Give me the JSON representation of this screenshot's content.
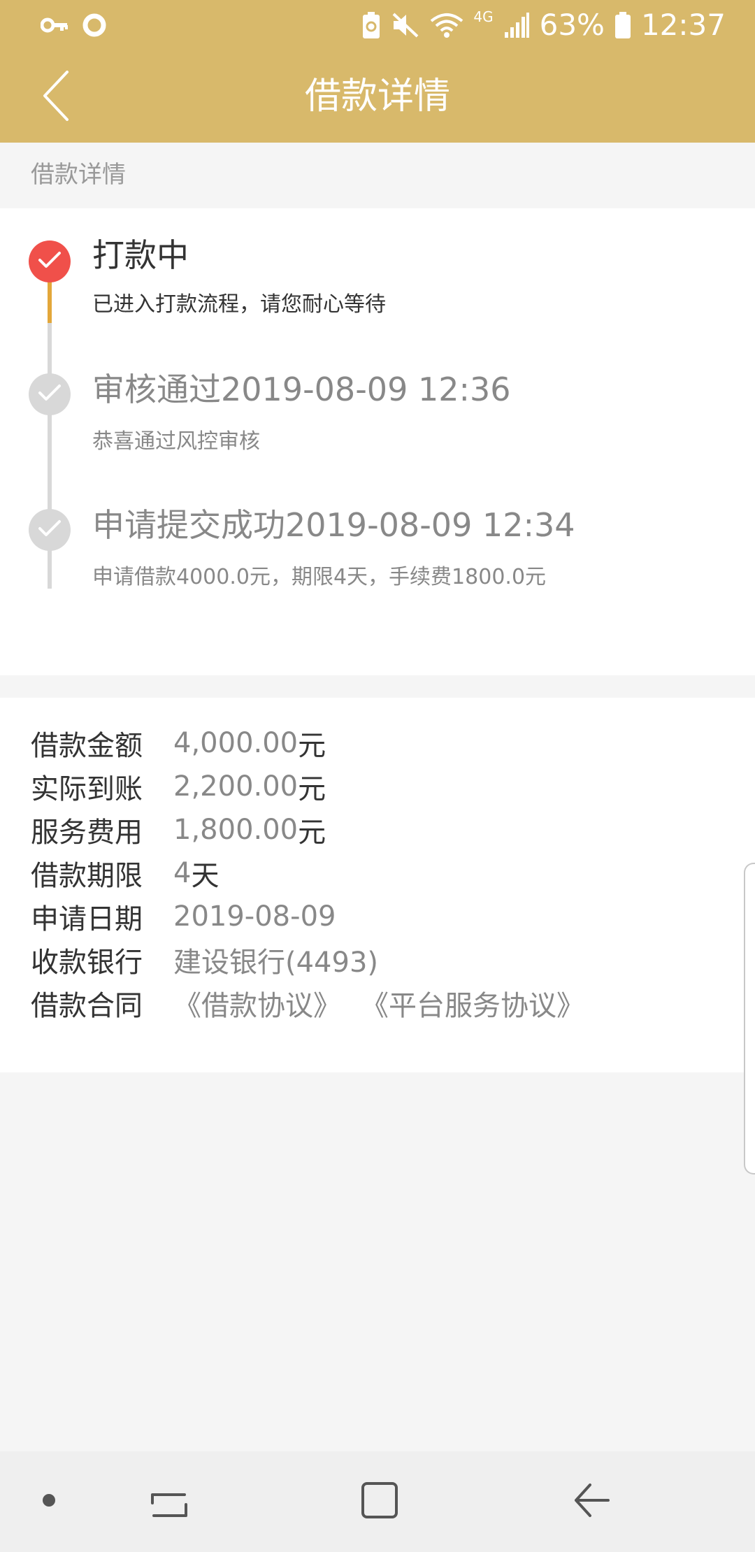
{
  "status_bar": {
    "battery": "63%",
    "time": "12:37",
    "network": "4G",
    "icons": [
      "key-icon",
      "circle-icon",
      "battery-saver-icon",
      "mute-icon",
      "wifi-icon",
      "signal-icon",
      "battery-icon"
    ]
  },
  "header": {
    "title": "借款详情",
    "back_icon": "chevron-left-icon"
  },
  "section_label": "借款详情",
  "timeline": [
    {
      "title": "打款中",
      "desc": "已进入打款流程，请您耐心等待",
      "active": true
    },
    {
      "title": "审核通过2019-08-09 12:36",
      "desc": "恭喜通过风控审核",
      "active": false
    },
    {
      "title": "申请提交成功2019-08-09 12:34",
      "desc": "申请借款4000.0元，期限4天，手续费1800.0元",
      "active": false
    }
  ],
  "details": {
    "loan_amount": {
      "label": "借款金额",
      "value": "4,000.00",
      "unit": "元"
    },
    "actual_received": {
      "label": "实际到账",
      "value": "2,200.00",
      "unit": "元"
    },
    "service_fee": {
      "label": "服务费用",
      "value": "1,800.00",
      "unit": "元"
    },
    "loan_term": {
      "label": "借款期限",
      "value": "4",
      "unit": "天"
    },
    "apply_date": {
      "label": "申请日期",
      "value": "2019-08-09"
    },
    "bank": {
      "label": "收款银行",
      "value": "建设银行(4493)"
    },
    "contract": {
      "label": "借款合同",
      "link1": "《借款协议》",
      "link2": "《平台服务协议》"
    }
  },
  "colors": {
    "header_bg": "#d8b96b",
    "active_red": "#f0504a",
    "timeline_gold": "#e3a73a",
    "inactive_gray": "#d8d8d8"
  },
  "nav_icons": [
    "dot-icon",
    "recent-apps-icon",
    "home-icon",
    "back-arrow-icon"
  ]
}
